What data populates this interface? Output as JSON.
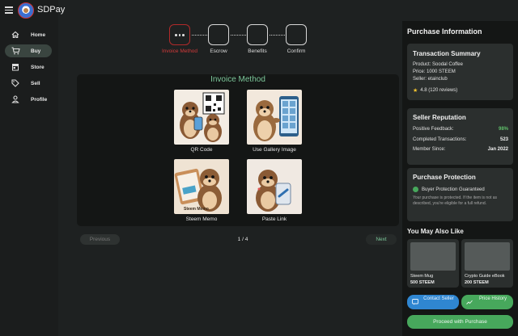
{
  "app": {
    "brand": "SDPay"
  },
  "sidebar": {
    "items": [
      {
        "label": "Home",
        "icon": "home-icon"
      },
      {
        "label": "Buy",
        "icon": "cart-icon",
        "active": true
      },
      {
        "label": "Store",
        "icon": "store-icon"
      },
      {
        "label": "Sell",
        "icon": "tag-icon"
      },
      {
        "label": "Profile",
        "icon": "person-icon"
      }
    ]
  },
  "stepper": {
    "steps": [
      {
        "label": "Invoice Method",
        "active": true
      },
      {
        "label": "Escrow"
      },
      {
        "label": "Benefits"
      },
      {
        "label": "Confirm"
      }
    ]
  },
  "invoice": {
    "title": "Invoice Method",
    "options": [
      {
        "label": "QR Code"
      },
      {
        "label": "Use Gallery Image"
      },
      {
        "label": "Steem Memo",
        "image_text": "Steem Memo"
      },
      {
        "label": "Paste Link"
      }
    ],
    "prev_label": "Previous",
    "page": "1 / 4",
    "next_label": "Next"
  },
  "purchase": {
    "title": "Purchase Information",
    "summary": {
      "title": "Transaction Summary",
      "product": "Product: Soodal Coffee",
      "price": "Price: 1000 STEEM",
      "seller": "Seller: etainclub",
      "rating": "4.8 (120 reviews)"
    },
    "reputation": {
      "title": "Seller Reputation",
      "rows": [
        {
          "label": "Positive Feedback:",
          "value": "98%",
          "color": "#5fbf6a"
        },
        {
          "label": "Completed Transactions:",
          "value": "523"
        },
        {
          "label": "Member Since:",
          "value": "Jan 2022"
        }
      ]
    },
    "protection": {
      "title": "Purchase Protection",
      "badge": "Buyer Protection Guaranteed",
      "note": "Your purchase is protected. If the item is not as described, you're eligible for a full refund."
    },
    "also_like": {
      "title": "You May Also Like",
      "products": [
        {
          "name": "Steem Mug",
          "price": "500 STEEM"
        },
        {
          "name": "Crypto Guide eBook",
          "price": "200 STEEM"
        }
      ]
    },
    "contact_label": "Contact Seller",
    "history_label": "Price History",
    "proceed_label": "Proceed with Purchase"
  },
  "colors": {
    "accent": "#47a85c",
    "title_green": "#7cc79a",
    "active_step": "#b12a2a",
    "blue": "#2f86d1"
  }
}
